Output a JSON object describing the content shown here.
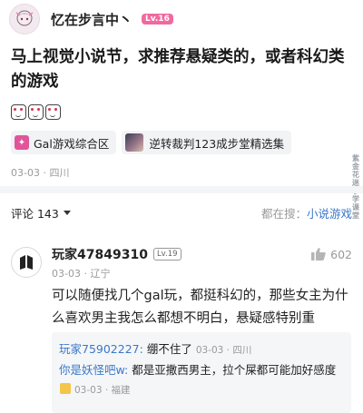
{
  "post": {
    "author": "忆在步言中丶",
    "author_level": "Lv.16",
    "title": "马上视觉小说节，求推荐悬疑类的，或者科幻类的游戏",
    "tags": [
      {
        "label": "Gal游戏综合区",
        "icon": "game-zone-icon"
      },
      {
        "label": "逆转裁判123成步堂精选集",
        "icon": "game-cover-thumbnail"
      }
    ],
    "meta": "03-03 · 四川",
    "emoji_count": 3,
    "side_watermark": "紫金花迷小学课堂"
  },
  "comments_bar": {
    "label": "评论 143",
    "search_prefix": "都在搜：",
    "search_keyword": "小说游戏"
  },
  "comment": {
    "username": "玩家47849310",
    "level": "Lv.19",
    "meta": "03-03 · 辽宁",
    "likes": "602",
    "body": "可以随便找几个gal玩，都挺科幻的，那些女主为什么喜欢男主我怎么都想不明白，悬疑感特别重",
    "replies": [
      {
        "name": "玩家75902227:",
        "text": " 绷不住了",
        "meta": "03-03 · 四川"
      },
      {
        "name": "你是妖怪吧w:",
        "text": " 都是亚撒西男主，拉个屎都可能加好感度",
        "meta": "03-03 · 福建"
      }
    ]
  },
  "colors": {
    "accent_pink": "#f06aa0",
    "link_blue": "#3a78c8",
    "meta_gray": "#9a9a9a"
  }
}
